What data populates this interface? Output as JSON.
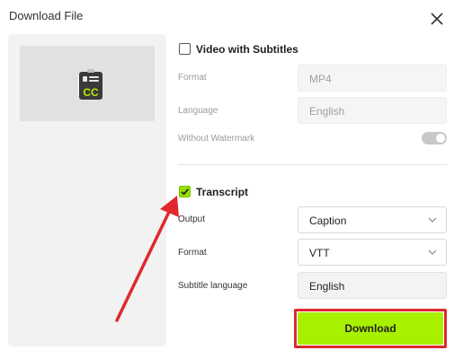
{
  "dialog": {
    "title": "Download File"
  },
  "video_section": {
    "label": "Video with Subtitles",
    "checked": false,
    "rows": {
      "format_label": "Format",
      "format_value": "MP4",
      "language_label": "Language",
      "language_value": "English",
      "watermark_label": "Without Watermark",
      "watermark_on": true
    }
  },
  "transcript_section": {
    "label": "Transcript",
    "checked": true,
    "rows": {
      "output_label": "Output",
      "output_value": "Caption",
      "format_label": "Format",
      "format_value": "VTT",
      "subtitle_language_label": "Subtitle language",
      "subtitle_language_value": "English"
    }
  },
  "actions": {
    "download_label": "Download"
  },
  "icons": {
    "close": "close-icon",
    "thumbnail": "closed-caption-file-icon",
    "checkmark": "checkmark-icon",
    "chevron": "chevron-down-icon"
  },
  "colors": {
    "accent": "#a8f000",
    "checkbox_checked": "#95e000",
    "highlight_outline": "#e0282e",
    "arrow": "#e0282e"
  }
}
